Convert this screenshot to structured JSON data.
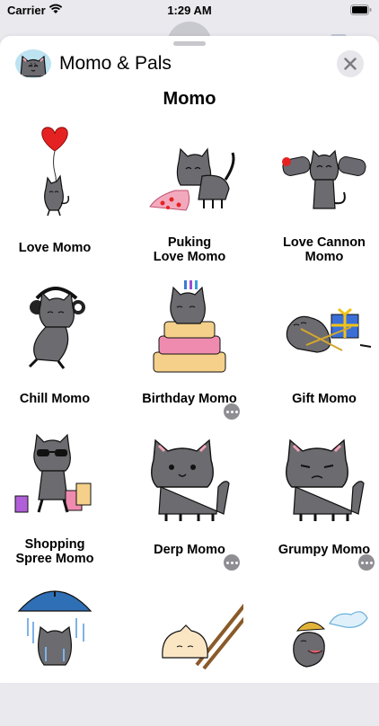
{
  "status_bar": {
    "carrier": "Carrier",
    "time": "1:29 AM"
  },
  "header": {
    "app_name": "Momo & Pals"
  },
  "section": {
    "title": "Momo"
  },
  "stickers": [
    {
      "label": "Love Momo"
    },
    {
      "label_line1": "Puking",
      "label_line2": "Love Momo"
    },
    {
      "label_line1": "Love Cannon",
      "label_line2": "Momo"
    },
    {
      "label": "Chill Momo"
    },
    {
      "label": "Birthday Momo"
    },
    {
      "label": "Gift Momo"
    },
    {
      "label_line1": "Shopping",
      "label_line2": "Spree Momo"
    },
    {
      "label": "Derp Momo"
    },
    {
      "label": "Grumpy Momo"
    }
  ],
  "colors": {
    "cat_gray": "#6b6b70",
    "balloon_red": "#e52222",
    "sheet_bg": "#ffffff",
    "outer_bg": "#e9e9ee"
  }
}
